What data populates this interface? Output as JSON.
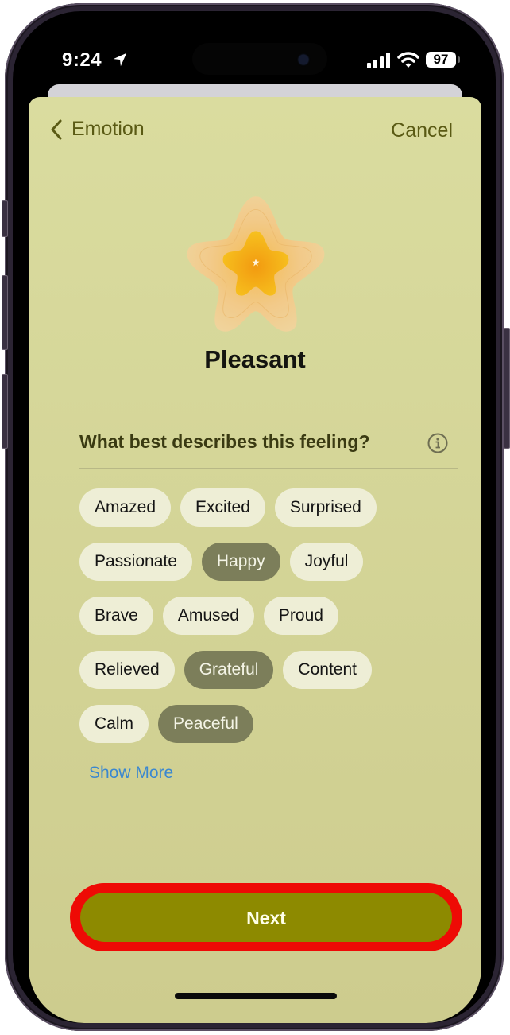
{
  "status_bar": {
    "time": "9:24",
    "location_icon": "location-arrow-icon",
    "signal_icon": "cellular-signal-icon",
    "wifi_icon": "wifi-icon",
    "battery_level": "97"
  },
  "nav": {
    "back_label": "Emotion",
    "back_icon": "chevron-left-icon",
    "cancel_label": "Cancel"
  },
  "emotion": {
    "icon": "flower-emotion-icon",
    "title": "Pleasant"
  },
  "question": {
    "label": "What best describes this feeling?",
    "info_icon": "info-circle-icon"
  },
  "chips": {
    "rows": [
      [
        {
          "label": "Amazed",
          "selected": false
        },
        {
          "label": "Excited",
          "selected": false
        },
        {
          "label": "Surprised",
          "selected": false
        }
      ],
      [
        {
          "label": "Passionate",
          "selected": false
        },
        {
          "label": "Happy",
          "selected": true
        },
        {
          "label": "Joyful",
          "selected": false
        }
      ],
      [
        {
          "label": "Brave",
          "selected": false
        },
        {
          "label": "Amused",
          "selected": false
        },
        {
          "label": "Proud",
          "selected": false
        }
      ],
      [
        {
          "label": "Relieved",
          "selected": false
        },
        {
          "label": "Grateful",
          "selected": true
        },
        {
          "label": "Content",
          "selected": false
        }
      ],
      [
        {
          "label": "Calm",
          "selected": false
        },
        {
          "label": "Peaceful",
          "selected": true
        }
      ]
    ]
  },
  "show_more_label": "Show More",
  "next_label": "Next",
  "colors": {
    "sheet_background": "#dadc9f",
    "accent_text": "#5a5a14",
    "chip_default": "#eeeed6",
    "chip_selected": "#7c7e5a",
    "link": "#3a87d0",
    "next_button": "#8d8a00",
    "highlight_ring": "#ee0a05"
  }
}
